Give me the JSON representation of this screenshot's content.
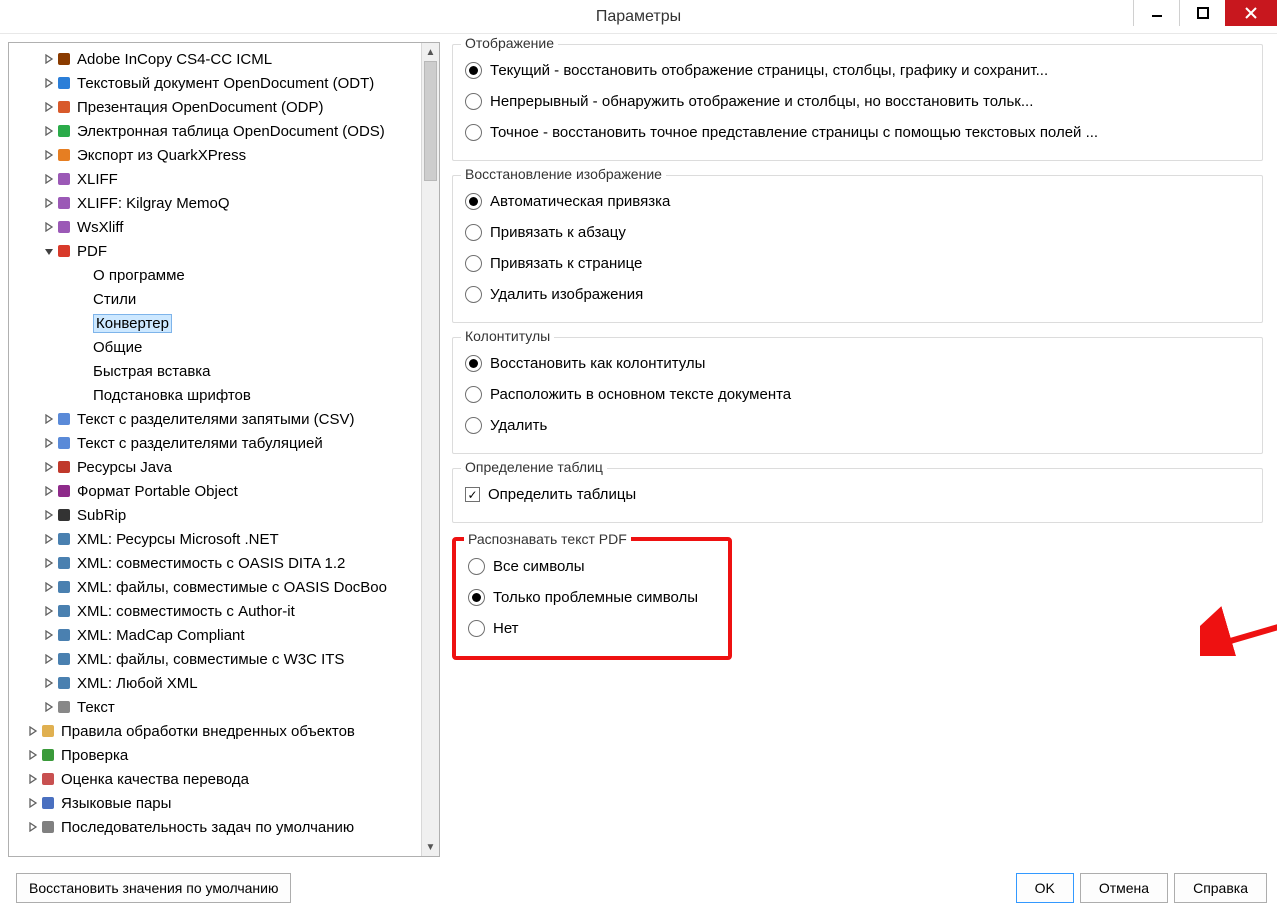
{
  "title": "Параметры",
  "tree": {
    "items": [
      {
        "label": "Adobe InCopy CS4-CC ICML",
        "depth": 2,
        "exp": "closed",
        "icon": "ic"
      },
      {
        "label": "Текстовый документ OpenDocument (ODT)",
        "depth": 2,
        "exp": "closed",
        "icon": "odt"
      },
      {
        "label": "Презентация OpenDocument (ODP)",
        "depth": 2,
        "exp": "closed",
        "icon": "odp"
      },
      {
        "label": "Электронная таблица OpenDocument (ODS)",
        "depth": 2,
        "exp": "closed",
        "icon": "ods"
      },
      {
        "label": "Экспорт из QuarkXPress",
        "depth": 2,
        "exp": "closed",
        "icon": "qx"
      },
      {
        "label": "XLIFF",
        "depth": 2,
        "exp": "closed",
        "icon": "xlf"
      },
      {
        "label": "XLIFF: Kilgray MemoQ",
        "depth": 2,
        "exp": "closed",
        "icon": "xlf"
      },
      {
        "label": "WsXliff",
        "depth": 2,
        "exp": "closed",
        "icon": "xlf"
      },
      {
        "label": "PDF",
        "depth": 2,
        "exp": "open",
        "icon": "pdf"
      },
      {
        "label": "О программе",
        "depth": 3,
        "exp": "none",
        "icon": "none"
      },
      {
        "label": "Стили",
        "depth": 3,
        "exp": "none",
        "icon": "none"
      },
      {
        "label": "Конвертер",
        "depth": 3,
        "exp": "none",
        "icon": "none",
        "selected": true
      },
      {
        "label": "Общие",
        "depth": 3,
        "exp": "none",
        "icon": "none"
      },
      {
        "label": "Быстрая вставка",
        "depth": 3,
        "exp": "none",
        "icon": "none"
      },
      {
        "label": "Подстановка шрифтов",
        "depth": 3,
        "exp": "none",
        "icon": "none"
      },
      {
        "label": "Текст с разделителями запятыми (CSV)",
        "depth": 2,
        "exp": "closed",
        "icon": "csv"
      },
      {
        "label": "Текст с разделителями табуляцией",
        "depth": 2,
        "exp": "closed",
        "icon": "tsv"
      },
      {
        "label": "Ресурсы Java",
        "depth": 2,
        "exp": "closed",
        "icon": "java"
      },
      {
        "label": "Формат Portable Object",
        "depth": 2,
        "exp": "closed",
        "icon": "po"
      },
      {
        "label": "SubRip",
        "depth": 2,
        "exp": "closed",
        "icon": "srt"
      },
      {
        "label": "XML: Ресурсы Microsoft .NET",
        "depth": 2,
        "exp": "closed",
        "icon": "xml"
      },
      {
        "label": "XML: совместимость с OASIS DITA 1.2",
        "depth": 2,
        "exp": "closed",
        "icon": "xml"
      },
      {
        "label": "XML: файлы, совместимые с OASIS DocBoo",
        "depth": 2,
        "exp": "closed",
        "icon": "xml"
      },
      {
        "label": "XML: совместимость с Author-it",
        "depth": 2,
        "exp": "closed",
        "icon": "xml"
      },
      {
        "label": "XML: MadCap Compliant",
        "depth": 2,
        "exp": "closed",
        "icon": "xml"
      },
      {
        "label": "XML: файлы, совместимые с W3C ITS",
        "depth": 2,
        "exp": "closed",
        "icon": "xml"
      },
      {
        "label": "XML: Любой XML",
        "depth": 2,
        "exp": "closed",
        "icon": "xml"
      },
      {
        "label": "Текст",
        "depth": 2,
        "exp": "closed",
        "icon": "txt"
      },
      {
        "label": "Правила обработки внедренных объектов",
        "depth": 1,
        "exp": "closed",
        "icon": "folder"
      },
      {
        "label": "Проверка",
        "depth": 1,
        "exp": "closed",
        "icon": "check"
      },
      {
        "label": "Оценка качества перевода",
        "depth": 1,
        "exp": "closed",
        "icon": "qa"
      },
      {
        "label": "Языковые пары",
        "depth": 1,
        "exp": "closed",
        "icon": "lang"
      },
      {
        "label": "Последовательность задач по умолчанию",
        "depth": 1,
        "exp": "closed",
        "icon": "gear"
      }
    ]
  },
  "groups": {
    "display": {
      "title": "Отображение",
      "options": [
        {
          "label": "Текущий - восстановить отображение страницы, столбцы, графику и сохранит...",
          "checked": true
        },
        {
          "label": "Непрерывный - обнаружить отображение и столбцы, но восстановить тольк...",
          "checked": false
        },
        {
          "label": "Точное - восстановить точное представление страницы с помощью текстовых полей ...",
          "checked": false
        }
      ]
    },
    "image_recovery": {
      "title": "Восстановление изображение",
      "options": [
        {
          "label": "Автоматическая привязка",
          "checked": true
        },
        {
          "label": "Привязать к абзацу",
          "checked": false
        },
        {
          "label": "Привязать к странице",
          "checked": false
        },
        {
          "label": "Удалить изображения",
          "checked": false
        }
      ]
    },
    "headers": {
      "title": "Колонтитулы",
      "options": [
        {
          "label": "Восстановить как колонтитулы",
          "checked": true
        },
        {
          "label": "Расположить в основном тексте документа",
          "checked": false
        },
        {
          "label": "Удалить",
          "checked": false
        }
      ]
    },
    "tables": {
      "title": "Определение таблиц",
      "option": {
        "label": "Определить таблицы",
        "checked": true
      }
    },
    "ocr": {
      "title": "Распознавать текст PDF",
      "options": [
        {
          "label": "Все символы",
          "checked": false
        },
        {
          "label": "Только проблемные символы",
          "checked": true
        },
        {
          "label": "Нет",
          "checked": false
        }
      ]
    }
  },
  "buttons": {
    "restore": "Восстановить значения по умолчанию",
    "ok": "OK",
    "cancel": "Отмена",
    "help": "Справка"
  }
}
